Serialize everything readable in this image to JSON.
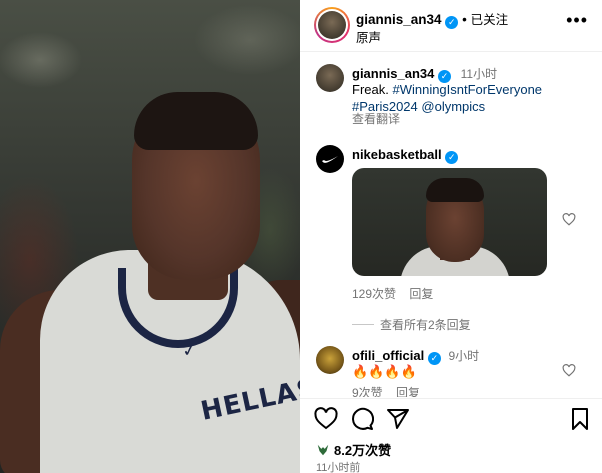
{
  "header": {
    "username": "giannis_an34",
    "follow_status": "已关注",
    "audio_label": "原声",
    "separator": "•",
    "more_glyph": "•••"
  },
  "caption": {
    "username": "giannis_an34",
    "time": "11小时",
    "text_plain": "Freak. ",
    "hashtag1": "#WinningIsntForEveryone",
    "hashtag2": "#Paris2024",
    "mention": "@olympics",
    "translate": "查看翻译"
  },
  "comments": [
    {
      "username": "nikebasketball",
      "likes": "129次赞",
      "reply": "回复",
      "view_replies": "查看所有2条回复"
    },
    {
      "username": "ofili_official",
      "time": "9小时",
      "text": "🔥🔥🔥🔥",
      "likes": "9次赞",
      "reply": "回复"
    }
  ],
  "footer": {
    "likes": "8.2万次赞",
    "posted": "11小时前"
  },
  "media": {
    "jersey_text": "HELLAS",
    "swoosh_glyph": "✓"
  },
  "icons": {
    "verified_glyph": "✓",
    "like": "heart-icon",
    "comment": "comment-icon",
    "share": "share-icon",
    "save": "bookmark-icon"
  },
  "colors": {
    "verified": "#0095f6",
    "link": "#00376b",
    "muted": "#737373"
  }
}
